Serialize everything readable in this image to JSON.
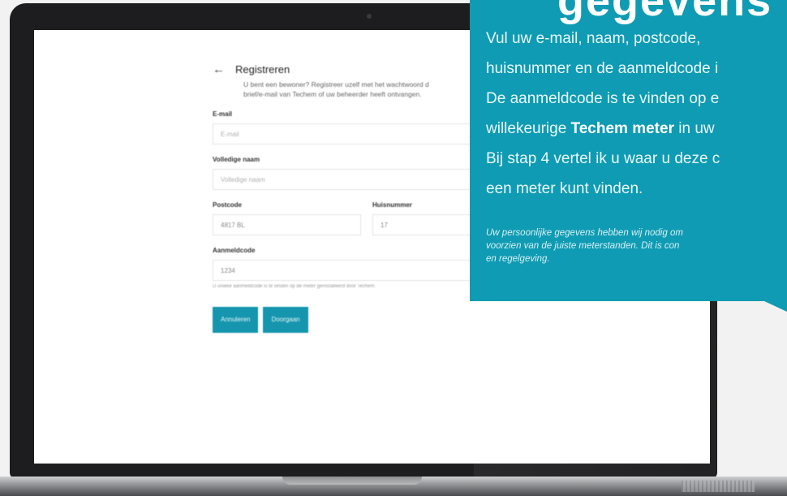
{
  "form": {
    "back_icon": "←",
    "title": "Registreren",
    "intro_line1": "U bent een bewoner? Registreer uzelf met het wachtwoord d",
    "intro_line2": "brief/e-mail van Techem of uw beheerder heeft ontvangen.",
    "email_label": "E-mail",
    "email_placeholder": "E-mail",
    "name_label": "Volledige naam",
    "name_placeholder": "Volledige naam",
    "postcode_label": "Postcode",
    "postcode_value": "4817 BL",
    "housenumber_label": "Huisnummer",
    "housenumber_value": "17",
    "code_label": "Aanmeldcode",
    "code_value": "1234",
    "code_helper": "U unieke aanmeldcode is te vinden op de meter geïnstalleerd door Techem.",
    "cancel_label": "Annuleren",
    "continue_label": "Doorgaan"
  },
  "card": {
    "heading": "gegevens",
    "line1": "Vul uw e-mail, naam, postcode,",
    "line2": "huisnummer en de aanmeldcode i",
    "line3": "De aanmeldcode is te vinden op e",
    "line4_pre": "willekeurige ",
    "line4_bold": "Techem meter",
    "line4_post": " in uw",
    "line5": "Bij stap 4 vertel ik u waar u deze c",
    "line6": "een meter kunt vinden.",
    "note1": "Uw persoonlijke gegevens hebben wij nodig om",
    "note2": "voorzien van de juiste meterstanden. Dit is con",
    "note3": "en regelgeving."
  },
  "colors": {
    "card_teal": "#0f9bb3",
    "button_teal": "#1596ae",
    "laptop_bezel": "#1d1d1f"
  }
}
